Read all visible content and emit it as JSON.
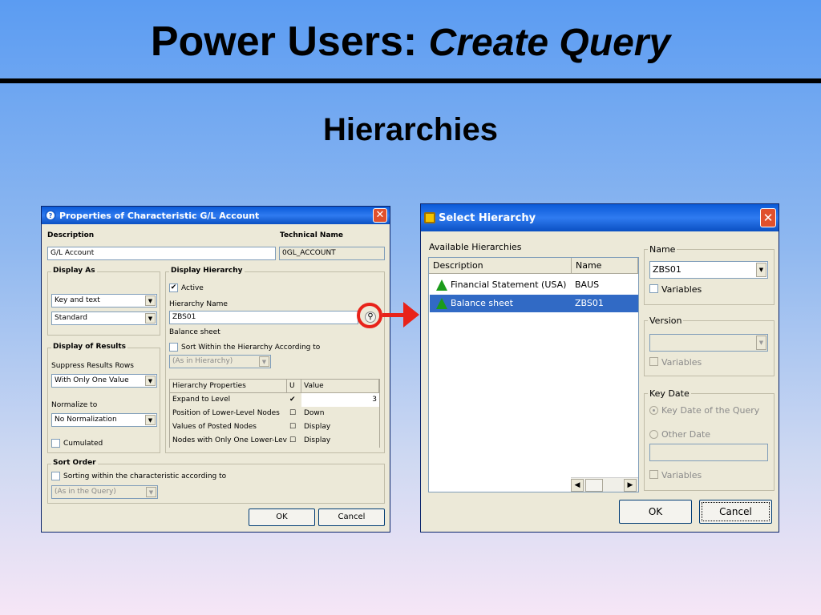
{
  "slide": {
    "title_plain": "Power Users: ",
    "title_italic": "Create Query",
    "subtitle": "Hierarchies"
  },
  "properties_dialog": {
    "title": "Properties of Characteristic G/L Account",
    "description_label": "Description",
    "description_value": "G/L Account",
    "technical_name_label": "Technical Name",
    "technical_name_value": "0GL_ACCOUNT",
    "display_as": {
      "label": "Display As",
      "combo1": "Key and text",
      "combo2": "Standard"
    },
    "display_hierarchy": {
      "label": "Display Hierarchy",
      "active_label": "Active",
      "active_checked": true,
      "hierarchy_name_label": "Hierarchy Name",
      "hierarchy_name_value": "ZBS01",
      "hierarchy_text": "Balance sheet",
      "sort_within_label": "Sort Within the Hierarchy According to",
      "sort_within_combo": "(As in Hierarchy)"
    },
    "display_results": {
      "label": "Display of Results",
      "suppress_label": "Suppress Results Rows",
      "suppress_value": "With Only One Value",
      "normalize_label": "Normalize to",
      "normalize_value": "No Normalization",
      "cumulated_label": "Cumulated"
    },
    "hierarchy_properties": {
      "headers": [
        "Hierarchy Properties",
        "U",
        "Value"
      ],
      "rows": [
        {
          "name": "Expand to Level",
          "u": "✔",
          "value": "3"
        },
        {
          "name": "Position of Lower-Level Nodes",
          "u": "",
          "value": "Down"
        },
        {
          "name": "Values of Posted Nodes",
          "u": "",
          "value": "Display"
        },
        {
          "name": "Nodes with Only One Lower-Level No",
          "u": "",
          "value": "Display"
        }
      ]
    },
    "sort_order": {
      "label": "Sort Order",
      "sorting_label": "Sorting within the characteristic according to",
      "combo": "(As in the Query)"
    },
    "ok_label": "OK",
    "cancel_label": "Cancel"
  },
  "select_dialog": {
    "title": "Select Hierarchy",
    "available_label": "Available Hierarchies",
    "columns": [
      "Description",
      "Name"
    ],
    "rows": [
      {
        "description": "Financial Statement (USA)",
        "name": "BAUS",
        "selected": false
      },
      {
        "description": "Balance sheet",
        "name": "ZBS01",
        "selected": true
      }
    ],
    "name_group": {
      "label": "Name",
      "combo": "ZBS01",
      "variables_label": "Variables"
    },
    "version_group": {
      "label": "Version",
      "combo": "",
      "variables_label": "Variables"
    },
    "key_date_group": {
      "label": "Key Date",
      "key_date_of_query_label": "Key Date of the Query",
      "other_date_label": "Other Date",
      "date_value": "",
      "variables_label": "Variables"
    },
    "ok_label": "OK",
    "cancel_label": "Cancel"
  },
  "colors": {
    "annotation_red": "#e8231a",
    "selection_blue": "#316ac5",
    "titlebar_blue": "#0a5ad8"
  }
}
